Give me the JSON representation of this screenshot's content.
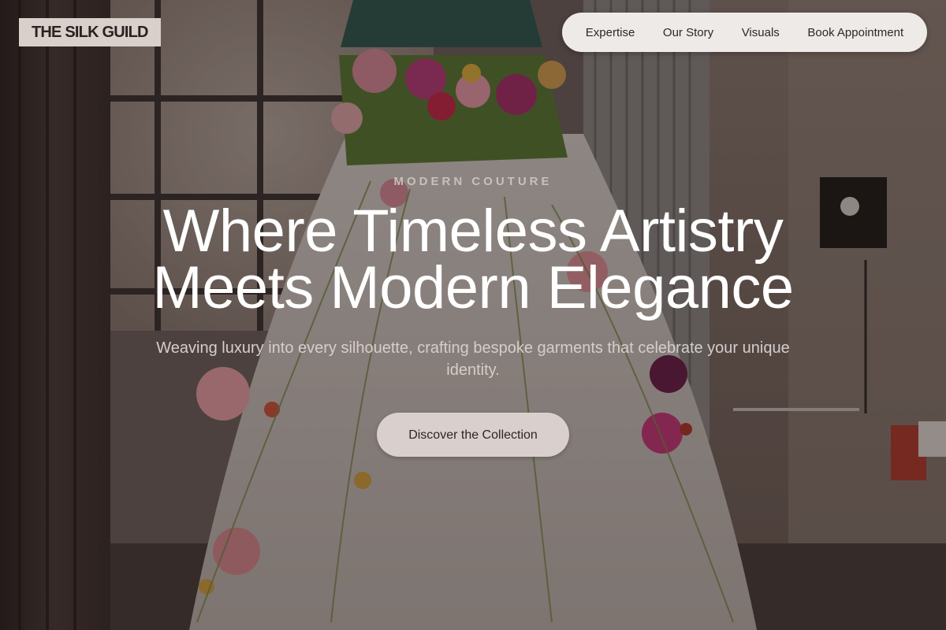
{
  "brand": {
    "logo_text": "THE SILK GUILD"
  },
  "nav": {
    "items": [
      {
        "label": "Expertise"
      },
      {
        "label": "Our Story"
      },
      {
        "label": "Visuals"
      },
      {
        "label": "Book Appointment"
      }
    ]
  },
  "hero": {
    "eyebrow": "MODERN COUTURE",
    "headline_line1": "Where Timeless Artistry",
    "headline_line2": "Meets Modern Elegance",
    "subtitle": "Weaving luxury into every silhouette, crafting bespoke garments that celebrate your unique identity.",
    "cta_label": "Discover the Collection"
  },
  "colors": {
    "logo_bg": "#d9cfcb",
    "nav_bg": "#eeeae8",
    "cta_bg": "#d9cfcc",
    "headline": "#ffffff",
    "subtitle": "#d6cecb"
  }
}
